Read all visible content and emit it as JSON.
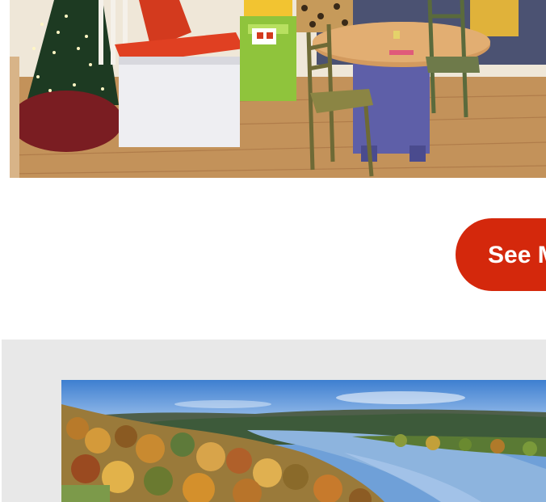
{
  "cta": {
    "label": "See More"
  },
  "colors": {
    "accent": "#d4280c",
    "section_bg": "#e8e8e8"
  },
  "images": {
    "top": "store-interior-photo",
    "bottom": "autumn-lake-landscape-photo"
  }
}
